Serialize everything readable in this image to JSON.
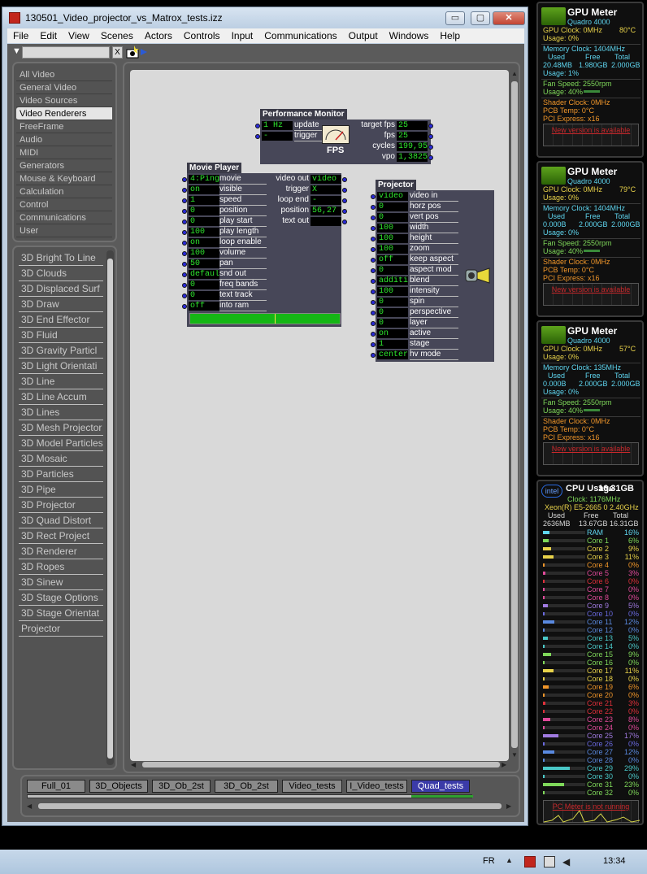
{
  "window": {
    "title": "130501_Video_projector_vs_Matrox_tests.izz",
    "controls": {
      "minimize": "▭",
      "maximize": "▢",
      "close": "✕"
    }
  },
  "menu": [
    "File",
    "Edit",
    "View",
    "Scenes",
    "Actors",
    "Controls",
    "Input",
    "Communications",
    "Output",
    "Windows",
    "Help"
  ],
  "search": {
    "clear_label": "X",
    "filter_arrow": "▼"
  },
  "categories": [
    "All Video",
    "General Video",
    "Video Sources",
    "Video Renderers",
    "FreeFrame",
    "Audio",
    "MIDI",
    "Generators",
    "Mouse & Keyboard",
    "Calculation",
    "Control",
    "Communications",
    "User"
  ],
  "selected_category": "Video Renderers",
  "actors": [
    "3D Bright To Line",
    "3D Clouds",
    "3D Displaced Surf",
    "3D Draw",
    "3D End Effector",
    "3D Fluid",
    "3D Gravity Particl",
    "3D Light Orientati",
    "3D Line",
    "3D Line Accum",
    "3D Lines",
    "3D Mesh Projector",
    "3D Model Particles",
    "3D Mosaic",
    "3D Particles",
    "3D Pipe",
    "3D Projector",
    "3D Quad Distort",
    "3D Rect Project",
    "3D Renderer",
    "3D Ropes",
    "3D Sinew",
    "3D Stage Options",
    "3D Stage Orientat",
    "Projector"
  ],
  "perf_monitor": {
    "title": "Performance Monitor",
    "inputs": [
      {
        "value": "1 Hz",
        "name": "update"
      },
      {
        "value": "-",
        "name": "trigger"
      }
    ],
    "outputs": [
      {
        "name": "target fps",
        "value": "25"
      },
      {
        "name": "fps",
        "value": "25"
      },
      {
        "name": "cycles",
        "value": "199,95"
      },
      {
        "name": "vpo",
        "value": "1,3825"
      }
    ],
    "gauge_label": "FPS"
  },
  "movie_player": {
    "title": "Movie Player",
    "inputs": [
      {
        "value": "4:Ping_",
        "name": "movie"
      },
      {
        "value": "on",
        "name": "visible"
      },
      {
        "value": "1",
        "name": "speed"
      },
      {
        "value": "0",
        "name": "position"
      },
      {
        "value": "0",
        "name": "play start"
      },
      {
        "value": "100",
        "name": "play length"
      },
      {
        "value": "on",
        "name": "loop enable"
      },
      {
        "value": "100",
        "name": "volume"
      },
      {
        "value": "50",
        "name": "pan"
      },
      {
        "value": "default",
        "name": "snd out"
      },
      {
        "value": "0",
        "name": "freq bands"
      },
      {
        "value": "0",
        "name": "text track"
      },
      {
        "value": "off",
        "name": "into ram"
      }
    ],
    "outputs": [
      {
        "name": "video out",
        "value": "video"
      },
      {
        "name": "trigger",
        "value": "X"
      },
      {
        "name": "loop end",
        "value": "-"
      },
      {
        "name": "position",
        "value": "56,27"
      },
      {
        "name": "text out",
        "value": ""
      }
    ],
    "progress": 0.56
  },
  "projector": {
    "title": "Projector",
    "inputs": [
      {
        "value": "video",
        "name": "video in"
      },
      {
        "value": "0",
        "name": "horz pos"
      },
      {
        "value": "0",
        "name": "vert pos"
      },
      {
        "value": "100",
        "name": "width"
      },
      {
        "value": "100",
        "name": "height"
      },
      {
        "value": "100",
        "name": "zoom"
      },
      {
        "value": "off",
        "name": "keep aspect"
      },
      {
        "value": "0",
        "name": "aspect mod"
      },
      {
        "value": "additive",
        "name": "blend"
      },
      {
        "value": "100",
        "name": "intensity"
      },
      {
        "value": "0",
        "name": "spin"
      },
      {
        "value": "0",
        "name": "perspective"
      },
      {
        "value": "0",
        "name": "layer"
      },
      {
        "value": "on",
        "name": "active"
      },
      {
        "value": "1",
        "name": "stage"
      },
      {
        "value": "centere",
        "name": "hv mode"
      }
    ]
  },
  "scenes": [
    "Full_01",
    "3D_Objects",
    "3D_Ob_2st",
    "3D_Ob_2st",
    "Video_tests",
    "I_Video_tests",
    "Quad_tests"
  ],
  "active_scene": "Quad_tests",
  "gpu_meters": [
    {
      "title": "GPU Meter",
      "model": "Quadro 4000",
      "gpu_clock": "GPU Clock: 0MHz",
      "temp": "80°C",
      "usage": "Usage: 0%",
      "mem_clock": "Memory Clock: 1404MHz",
      "headers": [
        "Used",
        "Free",
        "Total"
      ],
      "used": "20.48MB",
      "free": "1.980GB",
      "total": "2.000GB",
      "mem_usage": "Usage: 1%",
      "fan": "Fan Speed: 2550rpm",
      "fan_usage": "Usage: 40%",
      "shader": "Shader Clock: 0MHz",
      "pcb": "PCB Temp: 0°C",
      "pci": "PCI Express: x16",
      "warn": "New version is available"
    },
    {
      "title": "GPU Meter",
      "model": "Quadro 4000",
      "gpu_clock": "GPU Clock: 0MHz",
      "temp": "79°C",
      "usage": "Usage: 0%",
      "mem_clock": "Memory Clock: 1404MHz",
      "headers": [
        "Used",
        "Free",
        "Total"
      ],
      "used": "0.000B",
      "free": "2.000GB",
      "total": "2.000GB",
      "mem_usage": "Usage: 0%",
      "fan": "Fan Speed: 2550rpm",
      "fan_usage": "Usage: 40%",
      "shader": "Shader Clock: 0MHz",
      "pcb": "PCB Temp: 0°C",
      "pci": "PCI Express: x16",
      "warn": "New version is available"
    },
    {
      "title": "GPU Meter",
      "model": "Quadro 4000",
      "gpu_clock": "GPU Clock: 0MHz",
      "temp": "57°C",
      "usage": "Usage: 0%",
      "mem_clock": "Memory Clock: 135MHz",
      "headers": [
        "Used",
        "Free",
        "Total"
      ],
      "used": "0.000B",
      "free": "2.000GB",
      "total": "2.000GB",
      "mem_usage": "Usage: 0%",
      "fan": "Fan Speed: 2550rpm",
      "fan_usage": "Usage: 40%",
      "shader": "Shader Clock: 0MHz",
      "pcb": "PCB Temp: 0°C",
      "pci": "PCI Express: x16",
      "warn": "New version is available"
    }
  ],
  "cpu": {
    "title": "CPU Usage",
    "total": "16.31GB",
    "logo": "intel",
    "clock": "Clock: 1176MHz",
    "model": "Xeon(R) E5-2665 0 2.40GHz",
    "headers": [
      "Used",
      "Free",
      "Total"
    ],
    "used": "2636MB",
    "free": "13.67GB",
    "ram": {
      "name": "RAM",
      "value": "16%"
    },
    "cores": [
      {
        "name": "Core 1",
        "value": "6%",
        "color": "#7fd85a"
      },
      {
        "name": "Core 2",
        "value": "9%",
        "color": "#e8d24a"
      },
      {
        "name": "Core 3",
        "value": "11%",
        "color": "#e8d24a"
      },
      {
        "name": "Core 4",
        "value": "0%",
        "color": "#f0962a"
      },
      {
        "name": "Core 5",
        "value": "3%",
        "color": "#e04a9a"
      },
      {
        "name": "Core 6",
        "value": "0%",
        "color": "#e0303a"
      },
      {
        "name": "Core 7",
        "value": "0%",
        "color": "#e04a9a"
      },
      {
        "name": "Core 8",
        "value": "0%",
        "color": "#e04a9a"
      },
      {
        "name": "Core 9",
        "value": "5%",
        "color": "#a07ae0"
      },
      {
        "name": "Core 10",
        "value": "0%",
        "color": "#6a6ae0"
      },
      {
        "name": "Core 11",
        "value": "12%",
        "color": "#5a8ae0"
      },
      {
        "name": "Core 12",
        "value": "0%",
        "color": "#5a8ae0"
      },
      {
        "name": "Core 13",
        "value": "5%",
        "color": "#4ac8c8"
      },
      {
        "name": "Core 14",
        "value": "0%",
        "color": "#4ac8c8"
      },
      {
        "name": "Core 15",
        "value": "9%",
        "color": "#7fd85a"
      },
      {
        "name": "Core 16",
        "value": "0%",
        "color": "#7fd85a"
      },
      {
        "name": "Core 17",
        "value": "11%",
        "color": "#e8d24a"
      },
      {
        "name": "Core 18",
        "value": "0%",
        "color": "#e8d24a"
      },
      {
        "name": "Core 19",
        "value": "6%",
        "color": "#f0962a"
      },
      {
        "name": "Core 20",
        "value": "0%",
        "color": "#f0962a"
      },
      {
        "name": "Core 21",
        "value": "3%",
        "color": "#e0303a"
      },
      {
        "name": "Core 22",
        "value": "0%",
        "color": "#e0303a"
      },
      {
        "name": "Core 23",
        "value": "8%",
        "color": "#e04a9a"
      },
      {
        "name": "Core 24",
        "value": "0%",
        "color": "#e04a9a"
      },
      {
        "name": "Core 25",
        "value": "17%",
        "color": "#a07ae0"
      },
      {
        "name": "Core 26",
        "value": "0%",
        "color": "#6a6ae0"
      },
      {
        "name": "Core 27",
        "value": "12%",
        "color": "#5a8ae0"
      },
      {
        "name": "Core 28",
        "value": "0%",
        "color": "#5a8ae0"
      },
      {
        "name": "Core 29",
        "value": "29%",
        "color": "#4ac8c8"
      },
      {
        "name": "Core 30",
        "value": "0%",
        "color": "#4ac8c8"
      },
      {
        "name": "Core 31",
        "value": "23%",
        "color": "#7fd85a"
      },
      {
        "name": "Core 32",
        "value": "0%",
        "color": "#7fd85a"
      }
    ],
    "warn": "PC Meter is not running"
  },
  "taskbar": {
    "language": "FR",
    "time": "13:34"
  }
}
